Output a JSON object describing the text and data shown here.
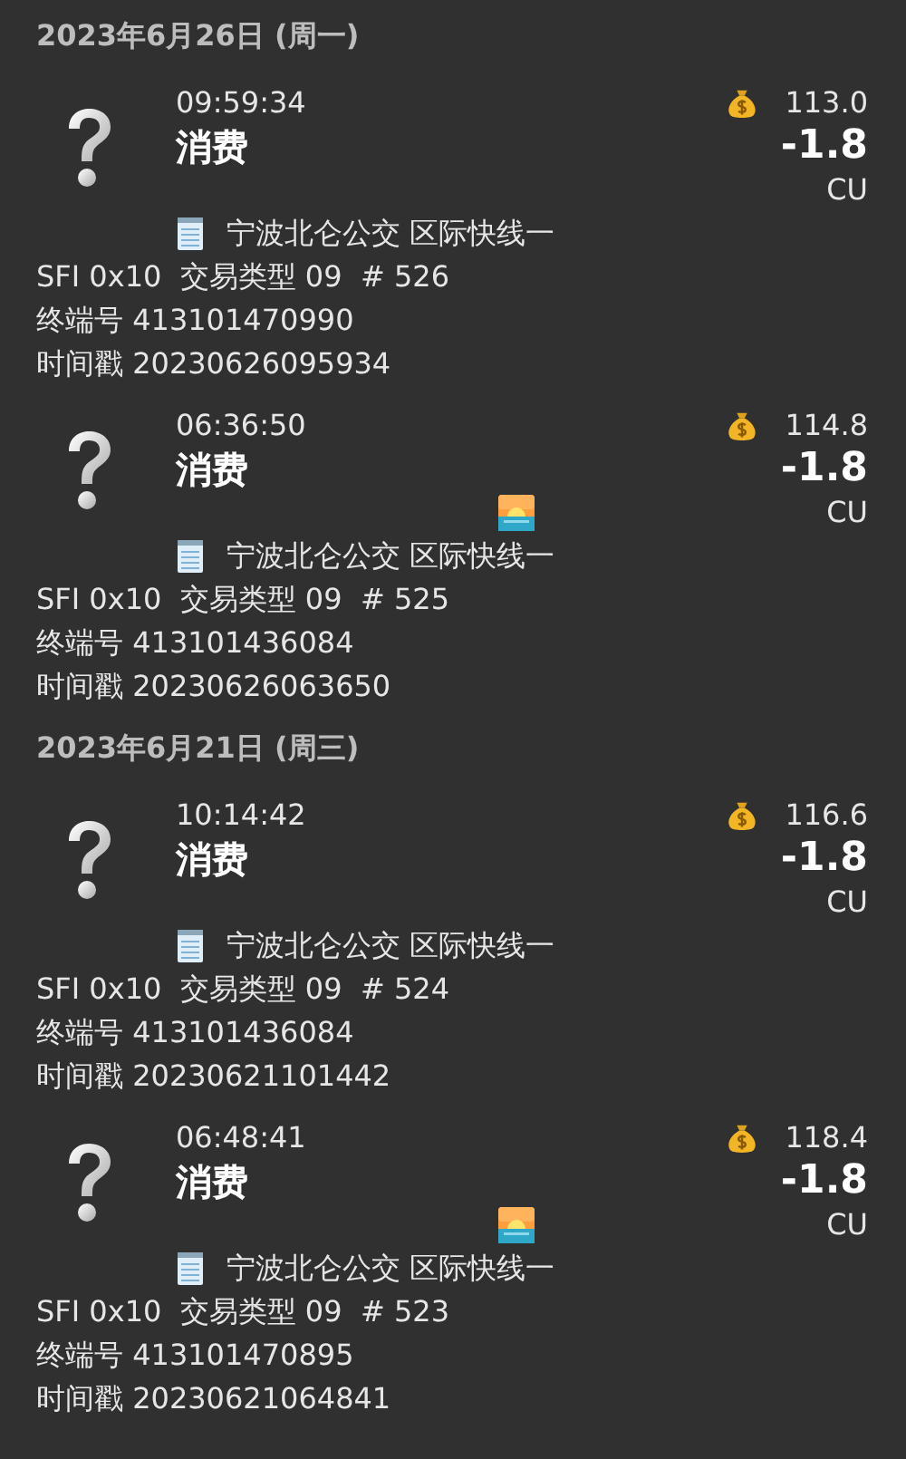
{
  "groups": [
    {
      "date": "2023年6月26日 (周一)",
      "transactions": [
        {
          "time": "09:59:34",
          "type": "消费",
          "balance": "113.0",
          "amount": "-1.8",
          "currency": "CU",
          "sunrise": false,
          "location": "宁波北仑公交 区际快线一",
          "sfi_line": "SFI 0x10  交易类型 09  # 526",
          "terminal": "终端号 413101470990",
          "timestamp": "时间戳 20230626095934"
        },
        {
          "time": "06:36:50",
          "type": "消费",
          "balance": "114.8",
          "amount": "-1.8",
          "currency": "CU",
          "sunrise": true,
          "location": "宁波北仑公交 区际快线一",
          "sfi_line": "SFI 0x10  交易类型 09  # 525",
          "terminal": "终端号 413101436084",
          "timestamp": "时间戳 20230626063650"
        }
      ]
    },
    {
      "date": "2023年6月21日 (周三)",
      "transactions": [
        {
          "time": "10:14:42",
          "type": "消费",
          "balance": "116.6",
          "amount": "-1.8",
          "currency": "CU",
          "sunrise": false,
          "location": "宁波北仑公交 区际快线一",
          "sfi_line": "SFI 0x10  交易类型 09  # 524",
          "terminal": "终端号 413101436084",
          "timestamp": "时间戳 20230621101442"
        },
        {
          "time": "06:48:41",
          "type": "消费",
          "balance": "118.4",
          "amount": "-1.8",
          "currency": "CU",
          "sunrise": true,
          "location": "宁波北仑公交 区际快线一",
          "sfi_line": "SFI 0x10  交易类型 09  # 523",
          "terminal": "终端号 413101470895",
          "timestamp": "时间戳 20230621064841"
        }
      ]
    }
  ]
}
